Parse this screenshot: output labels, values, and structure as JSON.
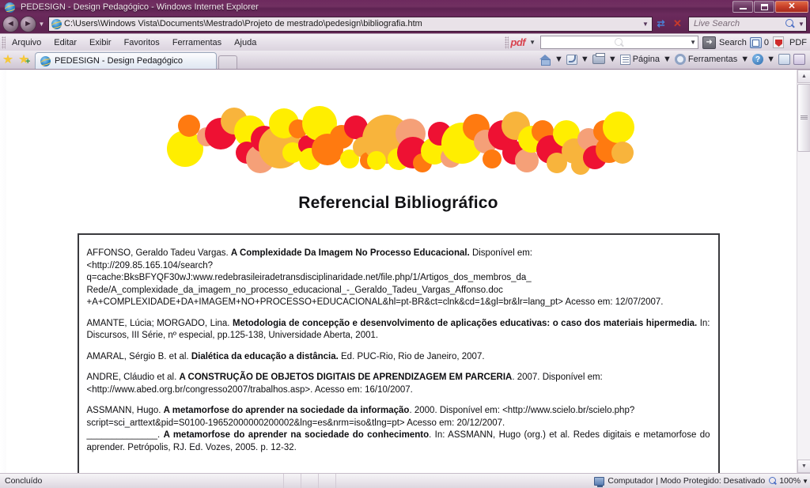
{
  "window": {
    "title": "PEDESIGN - Design Pedagógico - Windows Internet Explorer",
    "minimize_label": "Minimizar",
    "maximize_label": "Restaurar",
    "close_label": "Fechar"
  },
  "address_bar": {
    "back_label": "◄",
    "forward_label": "►",
    "history_drop": "▼",
    "url": "C:\\Users\\Windows Vista\\Documents\\Mestrado\\Projeto de mestrado\\pedesign\\bibliografia.htm",
    "url_drop": "▼",
    "refresh_label": "⟳",
    "stop_label": "✕",
    "search_placeholder": "Live Search",
    "search_drop": "▼"
  },
  "menu": {
    "items": [
      {
        "label": "Arquivo"
      },
      {
        "label": "Editar"
      },
      {
        "label": "Exibir"
      },
      {
        "label": "Favoritos"
      },
      {
        "label": "Ferramentas"
      },
      {
        "label": "Ajuda"
      }
    ]
  },
  "pdf_toolbar": {
    "brand": "pdf",
    "brand_drop": "▼",
    "search_value": "",
    "search_drop": "▼",
    "go_label": "➜",
    "search_label": "Search",
    "count": "0",
    "pdf_label": "PDF"
  },
  "tabs": {
    "favorites_star_label": "Favoritos",
    "add_favorite_label": "+",
    "items": [
      {
        "label": "PEDESIGN - Design Pedagógico",
        "active": true
      }
    ],
    "new_tab_label": ""
  },
  "command_bar": {
    "home_label": "",
    "home_drop": "▼",
    "feeds_label": "",
    "feeds_drop": "▼",
    "print_label": "",
    "print_drop": "▼",
    "page_label": "Página",
    "page_drop": "▼",
    "tools_label": "Ferramentas",
    "tools_drop": "▼",
    "help_label": "?",
    "help_drop": "▼"
  },
  "page": {
    "title": "Referencial Bibliográfico",
    "banner_colors": {
      "yellow": "#FFEE00",
      "orange": "#FF7A10",
      "red": "#EE1133",
      "amber": "#F8B43C",
      "salmon": "#F5A078"
    },
    "entries": [
      {
        "id": "affonso",
        "lines": [
          {
            "segments": [
              {
                "text": "AFFONSO, Geraldo Tadeu Vargas. ",
                "bold": false
              },
              {
                "text": "A Complexidade Da Imagem No Processo Educacional.",
                "bold": true
              },
              {
                "text": " Disponível em:",
                "bold": false
              }
            ],
            "justify": true
          },
          {
            "segments": [
              {
                "text": "<http://209.85.165.104/search?",
                "bold": false
              }
            ],
            "justify": false
          },
          {
            "segments": [
              {
                "text": "q=cache:BksBFYQF30wJ:www.redebrasileiradetransdisciplinaridade.net/file.php/1/Artigos_dos_membros_da_",
                "bold": false
              }
            ],
            "justify": false
          },
          {
            "segments": [
              {
                "text": "Rede/A_complexidade_da_imagem_no_processo_educacional_-_Geraldo_Tadeu_Vargas_Affonso.doc",
                "bold": false
              }
            ],
            "justify": false
          },
          {
            "segments": [
              {
                "text": "+A+COMPLEXIDADE+DA+IMAGEM+NO+PROCESSO+EDUCACIONAL&hl=pt-BR&ct=clnk&cd=1&gl=br&lr=lang_pt> Acesso em: 12/07/2007.",
                "bold": false
              }
            ],
            "justify": false
          }
        ]
      },
      {
        "id": "amante",
        "lines": [
          {
            "segments": [
              {
                "text": "AMANTE, Lúcia; MORGADO, Lina. ",
                "bold": false
              },
              {
                "text": "Metodologia de concepção e desenvolvimento de aplicações educativas: o caso dos materiais hipermedia.",
                "bold": true
              },
              {
                "text": " In: Discursos, III Série, nº especial, pp.125-138, Universidade Aberta, 2001.",
                "bold": false
              }
            ],
            "justify": true
          }
        ]
      },
      {
        "id": "amaral",
        "lines": [
          {
            "segments": [
              {
                "text": "AMARAL, Sérgio B. et al. ",
                "bold": false
              },
              {
                "text": "Dialética da educação a distância.",
                "bold": true
              },
              {
                "text": " Ed. PUC-Rio, Rio de Janeiro, 2007.",
                "bold": false
              }
            ],
            "justify": false
          }
        ]
      },
      {
        "id": "andre",
        "lines": [
          {
            "segments": [
              {
                "text": "ANDRE, Cláudio et al. ",
                "bold": false
              },
              {
                "text": "A CONSTRUÇÃO DE OBJETOS DIGITAIS DE APRENDIZAGEM EM PARCERIA",
                "bold": true
              },
              {
                "text": ". 2007. Disponível em:",
                "bold": false
              }
            ],
            "justify": true
          },
          {
            "segments": [
              {
                "text": "<http://www.abed.org.br/congresso2007/trabalhos.asp>. Acesso em: 16/10/2007.",
                "bold": false
              }
            ],
            "justify": false
          }
        ]
      },
      {
        "id": "assmann-1",
        "lines": [
          {
            "segments": [
              {
                "text": "ASSMANN, Hugo. ",
                "bold": false
              },
              {
                "text": "A metamorfose do aprender na sociedade da informação",
                "bold": true
              },
              {
                "text": ". 2000. Disponível em: <http://www.scielo.br/scielo.php?",
                "bold": false
              }
            ],
            "justify": true
          },
          {
            "segments": [
              {
                "text": "script=sci_arttext&pid=S0100-19652000000200002&lng=es&nrm=iso&tlng=pt> Acesso em: 20/12/2007.",
                "bold": false
              }
            ],
            "justify": false
          },
          {
            "segments": [
              {
                "text": "______________. ",
                "bold": false
              },
              {
                "text": "A metamorfose do aprender na sociedade do conhecimento",
                "bold": true
              },
              {
                "text": ". In: ASSMANN, Hugo (org.) et al. Redes digitais e metamorfose do aprender. Petrópolis, RJ. Ed. Vozes, 2005. p. 12-32.",
                "bold": false
              }
            ],
            "justify": true
          }
        ]
      }
    ]
  },
  "status_bar": {
    "status": "Concluído",
    "zone": "Computador | Modo Protegido: Desativado",
    "zoom": "100%",
    "zoom_drop": "▼"
  },
  "scrollbar": {
    "up_arrow": "▲",
    "down_arrow": "▼"
  }
}
